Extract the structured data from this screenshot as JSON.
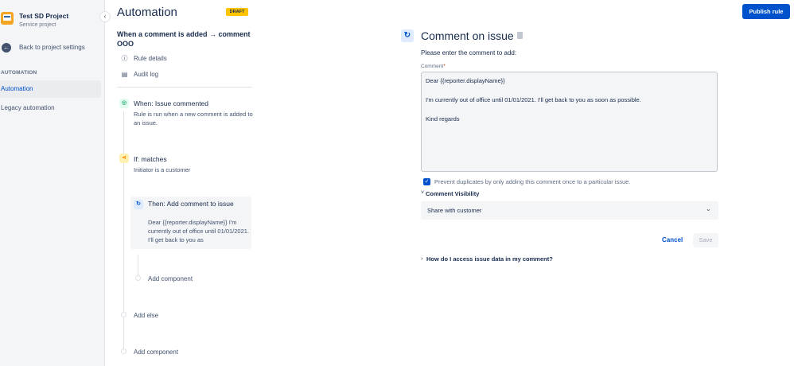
{
  "sidebar": {
    "project_name": "Test SD Project",
    "project_type": "Service project",
    "collapse_glyph": "‹",
    "back_label": "Back to project settings",
    "section_heading": "AUTOMATION",
    "items": [
      {
        "label": "Automation",
        "active": true
      },
      {
        "label": "Legacy automation",
        "active": false
      }
    ]
  },
  "main": {
    "title": "Automation",
    "status_badge": "DRAFT",
    "rule_name": "When a comment is added → comment OOO",
    "menu": [
      {
        "label": "Rule details",
        "icon": "info-icon"
      },
      {
        "label": "Audit log",
        "icon": "document-icon"
      }
    ]
  },
  "flow": {
    "trigger": {
      "title": "When: Issue commented",
      "description": "Rule is run when a new comment is added to an issue.",
      "icon": "comment-trigger-icon",
      "color": "#36b37e"
    },
    "condition": {
      "title": "If: matches",
      "description": "Initiator is a customer",
      "icon": "branch-icon",
      "color": "#ffab00"
    },
    "action": {
      "title": "Then: Add comment to issue",
      "description": "Dear {{reporter.displayName}} I'm currently out of office until 01/01/2021. I'll get back to you as",
      "icon": "add-comment-icon",
      "color": "#0052cc"
    },
    "add_component_inner": "Add component",
    "add_else": "Add else",
    "add_component_outer": "Add component"
  },
  "panel": {
    "publish_label": "Publish rule",
    "title": "Comment on issue",
    "instruction": "Please enter the comment to add:",
    "comment_label": "Comment",
    "required_mark": "*",
    "comment_lines": [
      "Dear {{reporter.displayName}}",
      "",
      "I'm currently out of office until 01/01/2021. I'll get back to you as soon as possible.",
      "",
      "Kind regards"
    ],
    "prevent_duplicates": {
      "checked": true,
      "label": "Prevent duplicates by only adding this comment once to a particular issue."
    },
    "visibility_heading": "Comment Visibility",
    "visibility_value": "Share with customer",
    "cancel_label": "Cancel",
    "save_label": "Save",
    "help_label": "How do I access issue data in my comment?"
  },
  "colors": {
    "primary": "#0052cc",
    "draft": "#ffc400"
  }
}
